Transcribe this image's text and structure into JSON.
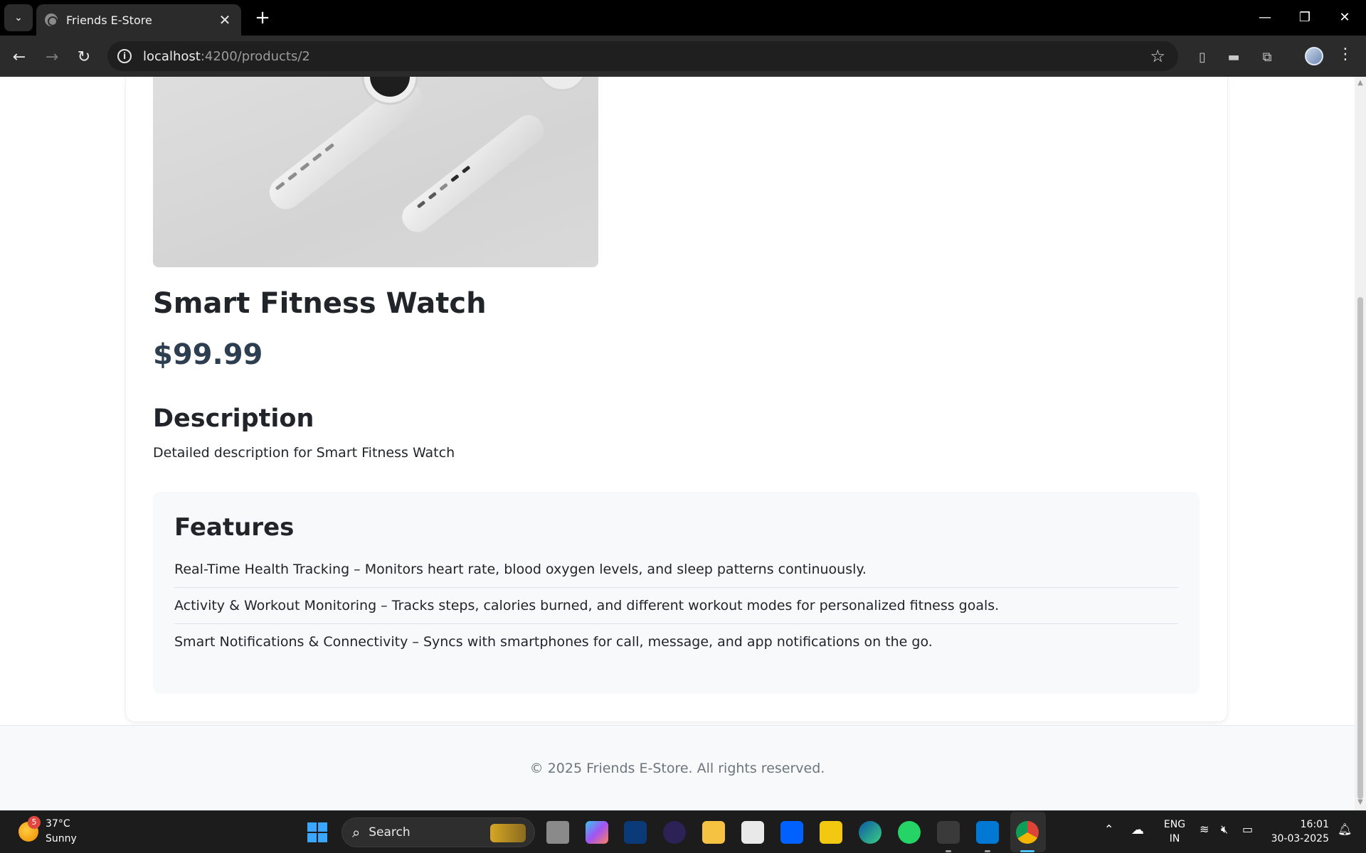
{
  "browser": {
    "tab_title": "Friends E-Store",
    "tab_close": "✕",
    "new_tab": "+",
    "url_host": "localhost",
    "url_path": ":4200/products/2",
    "window_controls": {
      "minimize": "—",
      "restore": "❐",
      "close": "✕"
    }
  },
  "product": {
    "title": "Smart Fitness Watch",
    "price": "$99.99",
    "description_heading": "Description",
    "description": "Detailed description for Smart Fitness Watch",
    "features_heading": "Features",
    "features": [
      "Real-Time Health Tracking – Monitors heart rate, blood oxygen levels, and sleep patterns continuously.",
      "Activity & Workout Monitoring – Tracks steps, calories burned, and different workout modes for personalized fitness goals.",
      "Smart Notifications & Connectivity – Syncs with smartphones for call, message, and app notifications on the go."
    ]
  },
  "footer": {
    "copyright": "© 2025 Friends E-Store. All rights reserved."
  },
  "taskbar": {
    "weather_badge": "5",
    "temperature": "37°C",
    "condition": "Sunny",
    "search_label": "Search",
    "lang_line1": "ENG",
    "lang_line2": "IN",
    "time": "16:01",
    "date": "30-03-2025"
  },
  "colors": {
    "price": "#2c3e50",
    "features_bg": "#f8f9fa",
    "footer_text": "#6c757d"
  }
}
